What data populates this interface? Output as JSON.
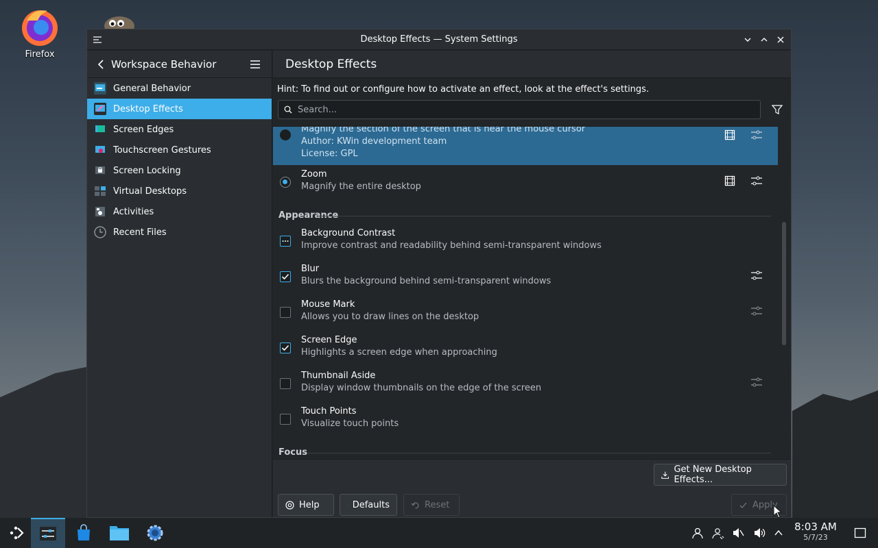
{
  "desktop": {
    "icons": [
      {
        "label": "Firefox"
      }
    ]
  },
  "window": {
    "title": "Desktop Effects — System Settings"
  },
  "sidebar": {
    "title": "Workspace Behavior",
    "items": [
      {
        "label": "General Behavior",
        "color": "#3daee9"
      },
      {
        "label": "Desktop Effects",
        "color": "#9b59b6"
      },
      {
        "label": "Screen Edges",
        "color": "#1abc9c"
      },
      {
        "label": "Touchscreen Gestures",
        "color": "#e91e63"
      },
      {
        "label": "Screen Locking",
        "color": "#5a6570"
      },
      {
        "label": "Virtual Desktops",
        "color": "#5a6570"
      },
      {
        "label": "Activities",
        "color": "#5a6570"
      },
      {
        "label": "Recent Files",
        "color": "#5a6570"
      }
    ]
  },
  "main": {
    "title": "Desktop Effects",
    "hint": "Hint: To find out or configure how to activate an effect, look at the effect's settings.",
    "search_placeholder": "Search...",
    "sections": {
      "appearance": "Appearance",
      "focus": "Focus"
    },
    "effects": [
      {
        "name": "",
        "desc": "Magnify the section of the screen that is near the mouse cursor",
        "author": "Author: KWin development team",
        "license": "License: GPL"
      },
      {
        "name": "Zoom",
        "desc": "Magnify the entire desktop"
      },
      {
        "name": "Background Contrast",
        "desc": "Improve contrast and readability behind semi-transparent windows"
      },
      {
        "name": "Blur",
        "desc": "Blurs the background behind semi-transparent windows"
      },
      {
        "name": "Mouse Mark",
        "desc": "Allows you to draw lines on the desktop"
      },
      {
        "name": "Screen Edge",
        "desc": "Highlights a screen edge when approaching"
      },
      {
        "name": "Thumbnail Aside",
        "desc": "Display window thumbnails on the edge of the screen"
      },
      {
        "name": "Touch Points",
        "desc": "Visualize touch points"
      }
    ],
    "get_new_label": "Get New Desktop Effects...",
    "help_label": "Help",
    "defaults_label": "Defaults",
    "reset_label": "Reset",
    "apply_label": "Apply"
  },
  "taskbar": {
    "time": "8:03 AM",
    "date": "5/7/23"
  }
}
